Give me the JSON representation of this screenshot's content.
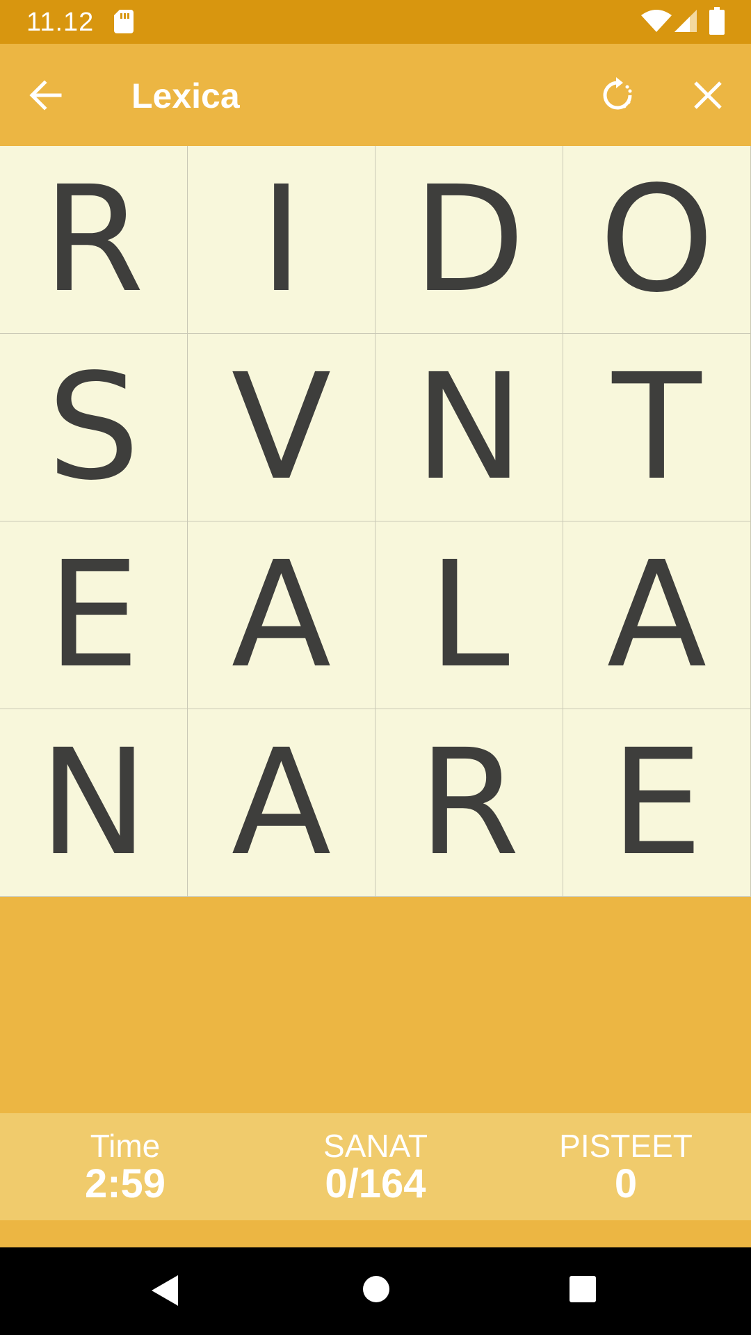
{
  "status_bar": {
    "time": "11.12",
    "icons": [
      "sd-card-icon",
      "wifi-icon",
      "signal-icon",
      "battery-icon"
    ]
  },
  "app_bar": {
    "title": "Lexica",
    "back_icon": "arrow-back-icon",
    "restart_icon": "restart-icon",
    "close_icon": "close-icon"
  },
  "board": {
    "rows": [
      [
        "R",
        "I",
        "D",
        "O"
      ],
      [
        "S",
        "V",
        "N",
        "T"
      ],
      [
        "E",
        "A",
        "L",
        "A"
      ],
      [
        "N",
        "A",
        "R",
        "E"
      ]
    ]
  },
  "stats": {
    "time_label": "Time",
    "time_value": "2:59",
    "words_label": "SANAT",
    "words_value": "0/164",
    "points_label": "PISTEET",
    "points_value": "0"
  },
  "nav_bar": {
    "icons": [
      "nav-back-icon",
      "nav-home-icon",
      "nav-recents-icon"
    ]
  },
  "colors": {
    "status_bar": "#D8960F",
    "app_bar": "#ECB643",
    "tile": "#F8F7DB",
    "tile_text": "#3E3E3C",
    "stats_bar": "#F0CB6C"
  }
}
